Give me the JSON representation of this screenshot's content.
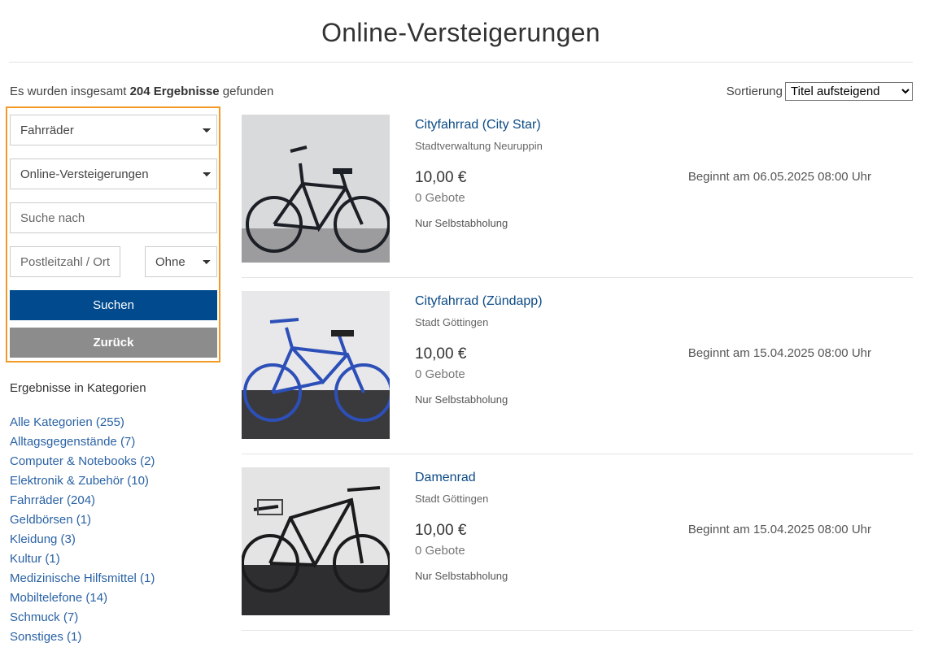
{
  "page": {
    "title": "Online-Versteigerungen"
  },
  "summary": {
    "prefix": "Es wurden insgesamt ",
    "count_text": "204 Ergebnisse",
    "suffix": " gefunden"
  },
  "sort": {
    "label": "Sortierung",
    "selected": "Titel aufsteigend"
  },
  "filter": {
    "category_selected": "Fahrräder",
    "type_selected": "Online-Versteigerungen",
    "search_placeholder": "Suche nach",
    "postcode_placeholder": "Postleitzahl / Ort",
    "radius_selected": "Ohne",
    "search_button": "Suchen",
    "back_button": "Zurück"
  },
  "categories": {
    "heading": "Ergebnisse in Kategorien",
    "items": [
      "Alle Kategorien (255)",
      "Alltagsgegenstände (7)",
      "Computer & Notebooks (2)",
      "Elektronik & Zubehör (10)",
      "Fahrräder (204)",
      "Geldbörsen (1)",
      "Kleidung (3)",
      "Kultur (1)",
      "Medizinische Hilfsmittel (1)",
      "Mobiltelefone (14)",
      "Schmuck (7)",
      "Sonstiges (1)"
    ]
  },
  "listings": [
    {
      "title": "Cityfahrrad (City Star)",
      "seller": "Stadtverwaltung Neuruppin",
      "price": "10,00 €",
      "bids": "0 Gebote",
      "pickup": "Nur Selbstabholung",
      "start": "Beginnt am 06.05.2025 08:00 Uhr",
      "bike_color": "#1c1f26",
      "bg": "#d9dadb"
    },
    {
      "title": "Cityfahrrad (Zündapp)",
      "seller": "Stadt Göttingen",
      "price": "10,00 €",
      "bids": "0 Gebote",
      "pickup": "Nur Selbstabholung",
      "start": "Beginnt am 15.04.2025 08:00 Uhr",
      "bike_color": "#2d4fb8",
      "bg": "#e8e8ea"
    },
    {
      "title": "Damenrad",
      "seller": "Stadt Göttingen",
      "price": "10,00 €",
      "bids": "0 Gebote",
      "pickup": "Nur Selbstabholung",
      "start": "Beginnt am 15.04.2025 08:00 Uhr",
      "bike_color": "#1b1b1d",
      "bg": "#e4e4e4"
    }
  ]
}
